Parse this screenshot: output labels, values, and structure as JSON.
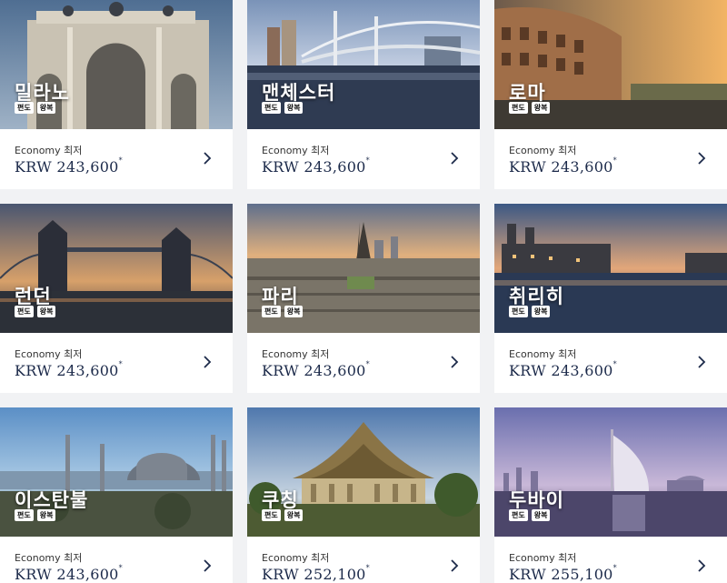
{
  "fare_class_label": "Economy 최저",
  "tags": [
    "편도",
    "왕복"
  ],
  "destinations": [
    {
      "city": "밀라노",
      "currency": "KRW",
      "price": "243,600",
      "mark": "*"
    },
    {
      "city": "맨체스터",
      "currency": "KRW",
      "price": "243,600",
      "mark": "*"
    },
    {
      "city": "로마",
      "currency": "KRW",
      "price": "243,600",
      "mark": "*"
    },
    {
      "city": "런던",
      "currency": "KRW",
      "price": "243,600",
      "mark": "*"
    },
    {
      "city": "파리",
      "currency": "KRW",
      "price": "243,600",
      "mark": "*"
    },
    {
      "city": "취리히",
      "currency": "KRW",
      "price": "243,600",
      "mark": "*"
    },
    {
      "city": "이스탄불",
      "currency": "KRW",
      "price": "243,600",
      "mark": "*"
    },
    {
      "city": "쿠칭",
      "currency": "KRW",
      "price": "252,100",
      "mark": "*"
    },
    {
      "city": "두바이",
      "currency": "KRW",
      "price": "255,100",
      "mark": "*"
    }
  ],
  "icons": {
    "next": "chevron-right-icon"
  },
  "colors": {
    "price_text": "#1c2a4a",
    "card_bg": "#ffffff",
    "page_bg": "#f1f2f4"
  }
}
